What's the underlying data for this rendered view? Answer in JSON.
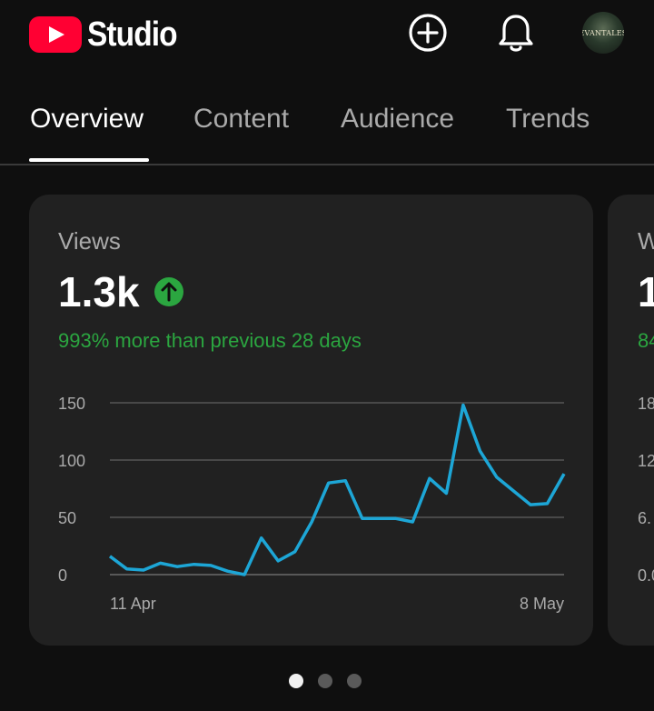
{
  "app": {
    "logo_text": "Studio",
    "brand_color": "#ff0033",
    "channel_avatar_text": "EVANTALES"
  },
  "header_icons": [
    "add-icon",
    "bell-icon"
  ],
  "tabs": [
    {
      "label": "Overview",
      "active": true
    },
    {
      "label": "Content",
      "active": false
    },
    {
      "label": "Audience",
      "active": false
    },
    {
      "label": "Trends",
      "active": false
    }
  ],
  "cards": [
    {
      "title": "Views",
      "value": "1.3k",
      "trend": "up",
      "compare": "993% more than previous 28 days",
      "compare_color": "#2ba640"
    },
    {
      "title": "W",
      "value": "1",
      "compare": "84",
      "y_ticks": [
        "18",
        "12",
        "6.",
        "0.0"
      ]
    }
  ],
  "pagination": {
    "count": 3,
    "active_index": 0
  },
  "chart_data": {
    "type": "line",
    "title": "Views",
    "x_labels": [
      "11 Apr",
      "8 May"
    ],
    "x": [
      1,
      2,
      3,
      4,
      5,
      6,
      7,
      8,
      9,
      10,
      11,
      12,
      13,
      14,
      15,
      16,
      17,
      18,
      19,
      20,
      21,
      22,
      23,
      24,
      25,
      26,
      27,
      28
    ],
    "series": [
      {
        "values": [
          16,
          5,
          4,
          10,
          7,
          9,
          8,
          3,
          0,
          32,
          12,
          20,
          46,
          80,
          82,
          49,
          49,
          49,
          46,
          84,
          71,
          148,
          108,
          85,
          73,
          61,
          62,
          88
        ],
        "color": "#1da6d6"
      }
    ],
    "y_ticks": [
      0,
      50,
      100,
      150
    ],
    "ylim": [
      0,
      150
    ],
    "grid": true,
    "line_color": "#1da6d6"
  }
}
